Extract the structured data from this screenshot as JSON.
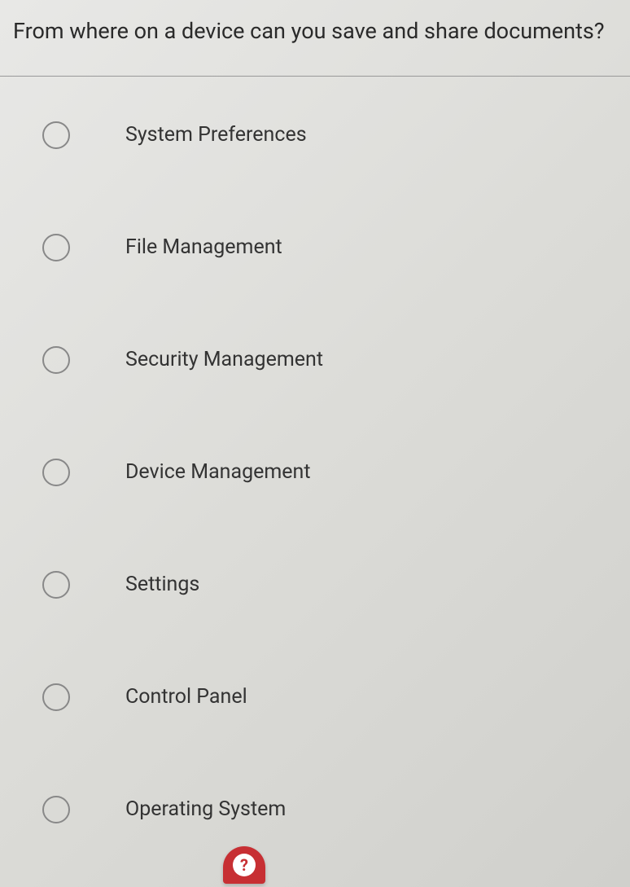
{
  "question": "From where on a device can you save and share documents?",
  "options": [
    {
      "label": "System Preferences"
    },
    {
      "label": "File Management"
    },
    {
      "label": "Security Management"
    },
    {
      "label": "Device Management"
    },
    {
      "label": "Settings"
    },
    {
      "label": "Control Panel"
    },
    {
      "label": "Operating System"
    }
  ],
  "help_icon": "?"
}
